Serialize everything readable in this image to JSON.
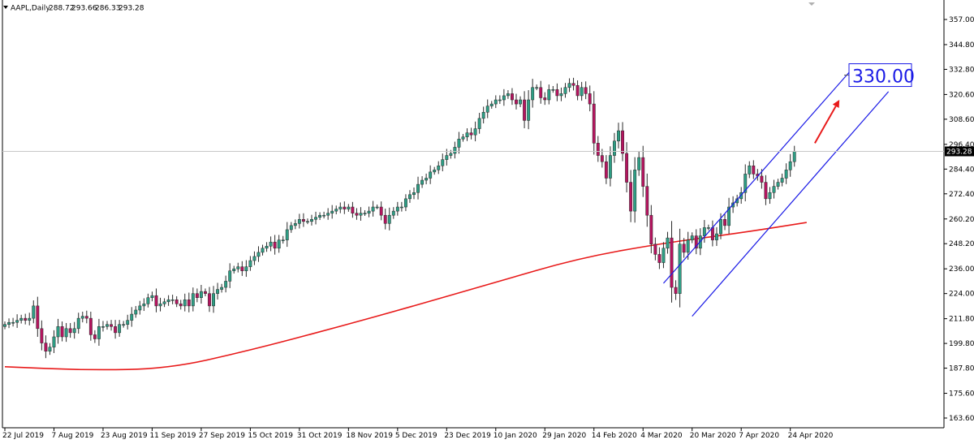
{
  "chart_data": {
    "type": "candlestick",
    "header": {
      "symbol_label": "AAPL,Daily",
      "open": "288.72",
      "high": "293.66",
      "low": "286.33",
      "close": "293.28"
    },
    "current_price_label": "293.28",
    "target_label": "330.00",
    "y_range": [
      163.0,
      364.0
    ],
    "grid": false,
    "y_ticks": [
      "357.00",
      "344.80",
      "332.80",
      "320.60",
      "308.60",
      "296.40",
      "284.40",
      "272.40",
      "260.20",
      "248.20",
      "236.00",
      "224.00",
      "211.80",
      "199.80",
      "187.80",
      "175.60",
      "163.60"
    ],
    "x_ticks": [
      {
        "i": 0,
        "label": "22 Jul 2019"
      },
      {
        "i": 12,
        "label": "7 Aug 2019"
      },
      {
        "i": 24,
        "label": "23 Aug 2019"
      },
      {
        "i": 36,
        "label": "11 Sep 2019"
      },
      {
        "i": 48,
        "label": "27 Sep 2019"
      },
      {
        "i": 60,
        "label": "15 Oct 2019"
      },
      {
        "i": 72,
        "label": "31 Oct 2019"
      },
      {
        "i": 84,
        "label": "18 Nov 2019"
      },
      {
        "i": 96,
        "label": "5 Dec 2019"
      },
      {
        "i": 108,
        "label": "23 Dec 2019"
      },
      {
        "i": 120,
        "label": "10 Jan 2020"
      },
      {
        "i": 132,
        "label": "29 Jan 2020"
      },
      {
        "i": 144,
        "label": "14 Feb 2020"
      },
      {
        "i": 156,
        "label": "4 Mar 2020"
      },
      {
        "i": 168,
        "label": "20 Mar 2020"
      },
      {
        "i": 180,
        "label": "7 Apr 2020"
      },
      {
        "i": 192,
        "label": "24 Apr 2020"
      }
    ],
    "closes": [
      209,
      210,
      210,
      211,
      212,
      211,
      212,
      218,
      207,
      200,
      196,
      198,
      203,
      208,
      203,
      207,
      205,
      207,
      212,
      213,
      212,
      204,
      202,
      208,
      208,
      209,
      208,
      205,
      209,
      209,
      211,
      214,
      216,
      218,
      219,
      222,
      223,
      218,
      219,
      220,
      221,
      221,
      219,
      218,
      221,
      218,
      224,
      222,
      225,
      224,
      218,
      224,
      226,
      227,
      230,
      235,
      236,
      237,
      235,
      237,
      240,
      242,
      244,
      246,
      247,
      249,
      246,
      250,
      250,
      255,
      257,
      258,
      260,
      259,
      259,
      260,
      261,
      262,
      262,
      263,
      264,
      265,
      266,
      265,
      266,
      263,
      262,
      263,
      263,
      264,
      266,
      266,
      262,
      258,
      262,
      264,
      266,
      266,
      270,
      272,
      273,
      277,
      279,
      280,
      283,
      284,
      286,
      289,
      291,
      292,
      295,
      299,
      300,
      302,
      301,
      304,
      309,
      312,
      315,
      316,
      318,
      318,
      320,
      321,
      318,
      316,
      318,
      308,
      318,
      324,
      324,
      319,
      318,
      323,
      323,
      320,
      321,
      324,
      326,
      325,
      320,
      324,
      321,
      316,
      297,
      291,
      288,
      280,
      291,
      298,
      303,
      292,
      278,
      264,
      284,
      290,
      276,
      262,
      248,
      243,
      239,
      246,
      251,
      227,
      224,
      248,
      244,
      250,
      252,
      246,
      252,
      256,
      256,
      250,
      253,
      260,
      257,
      266,
      268,
      270,
      273,
      282,
      286,
      282,
      281,
      278,
      270,
      273,
      276,
      278,
      280,
      284,
      288,
      293
    ],
    "ma": [
      {
        "i": 0,
        "v": 188.5
      },
      {
        "i": 20,
        "v": 186.8
      },
      {
        "i": 40,
        "v": 187.5
      },
      {
        "i": 60,
        "v": 196.5
      },
      {
        "i": 80,
        "v": 207.0
      },
      {
        "i": 100,
        "v": 218.0
      },
      {
        "i": 120,
        "v": 229.5
      },
      {
        "i": 140,
        "v": 241.0
      },
      {
        "i": 160,
        "v": 248.2
      },
      {
        "i": 180,
        "v": 253.5
      },
      {
        "i": 196,
        "v": 258.5
      }
    ],
    "channel": {
      "upper": [
        {
          "i": 161,
          "v": 229
        },
        {
          "i": 208,
          "v": 335
        }
      ],
      "lower": [
        {
          "i": 168,
          "v": 213
        },
        {
          "i": 216,
          "v": 322
        }
      ]
    },
    "arrow": [
      {
        "i": 198,
        "v": 297
      },
      {
        "i": 204,
        "v": 318
      }
    ],
    "colors": {
      "bull": "#2e9e85",
      "bear": "#b5145f",
      "ma": "#e81a1a",
      "channel": "#1a1ae6",
      "arrow": "#e81a1a",
      "target_text": "#1a1ae6"
    }
  }
}
